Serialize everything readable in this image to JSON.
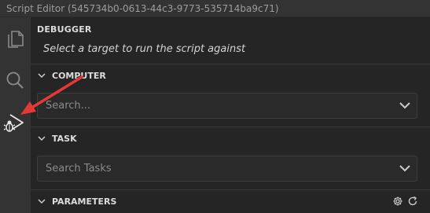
{
  "window": {
    "title": "Script Editor (545734b0-0613-44c3-9773-535714ba9c71)"
  },
  "activity_bar": {
    "items": [
      {
        "icon": "files-icon"
      },
      {
        "icon": "search-icon"
      },
      {
        "icon": "debug-icon"
      }
    ]
  },
  "panel": {
    "title": "DEBUGGER",
    "subtitle": "Select a target to run the script against"
  },
  "sections": {
    "computer": {
      "label": "COMPUTER",
      "placeholder": "Search..."
    },
    "task": {
      "label": "TASK",
      "placeholder": "Search Tasks"
    },
    "parameters": {
      "label": "PARAMETERS",
      "actions": [
        "gear-icon",
        "refresh-icon"
      ]
    }
  },
  "colors": {
    "annotation_arrow": "#e53935",
    "background": "#252526",
    "activity_bar": "#333333"
  }
}
